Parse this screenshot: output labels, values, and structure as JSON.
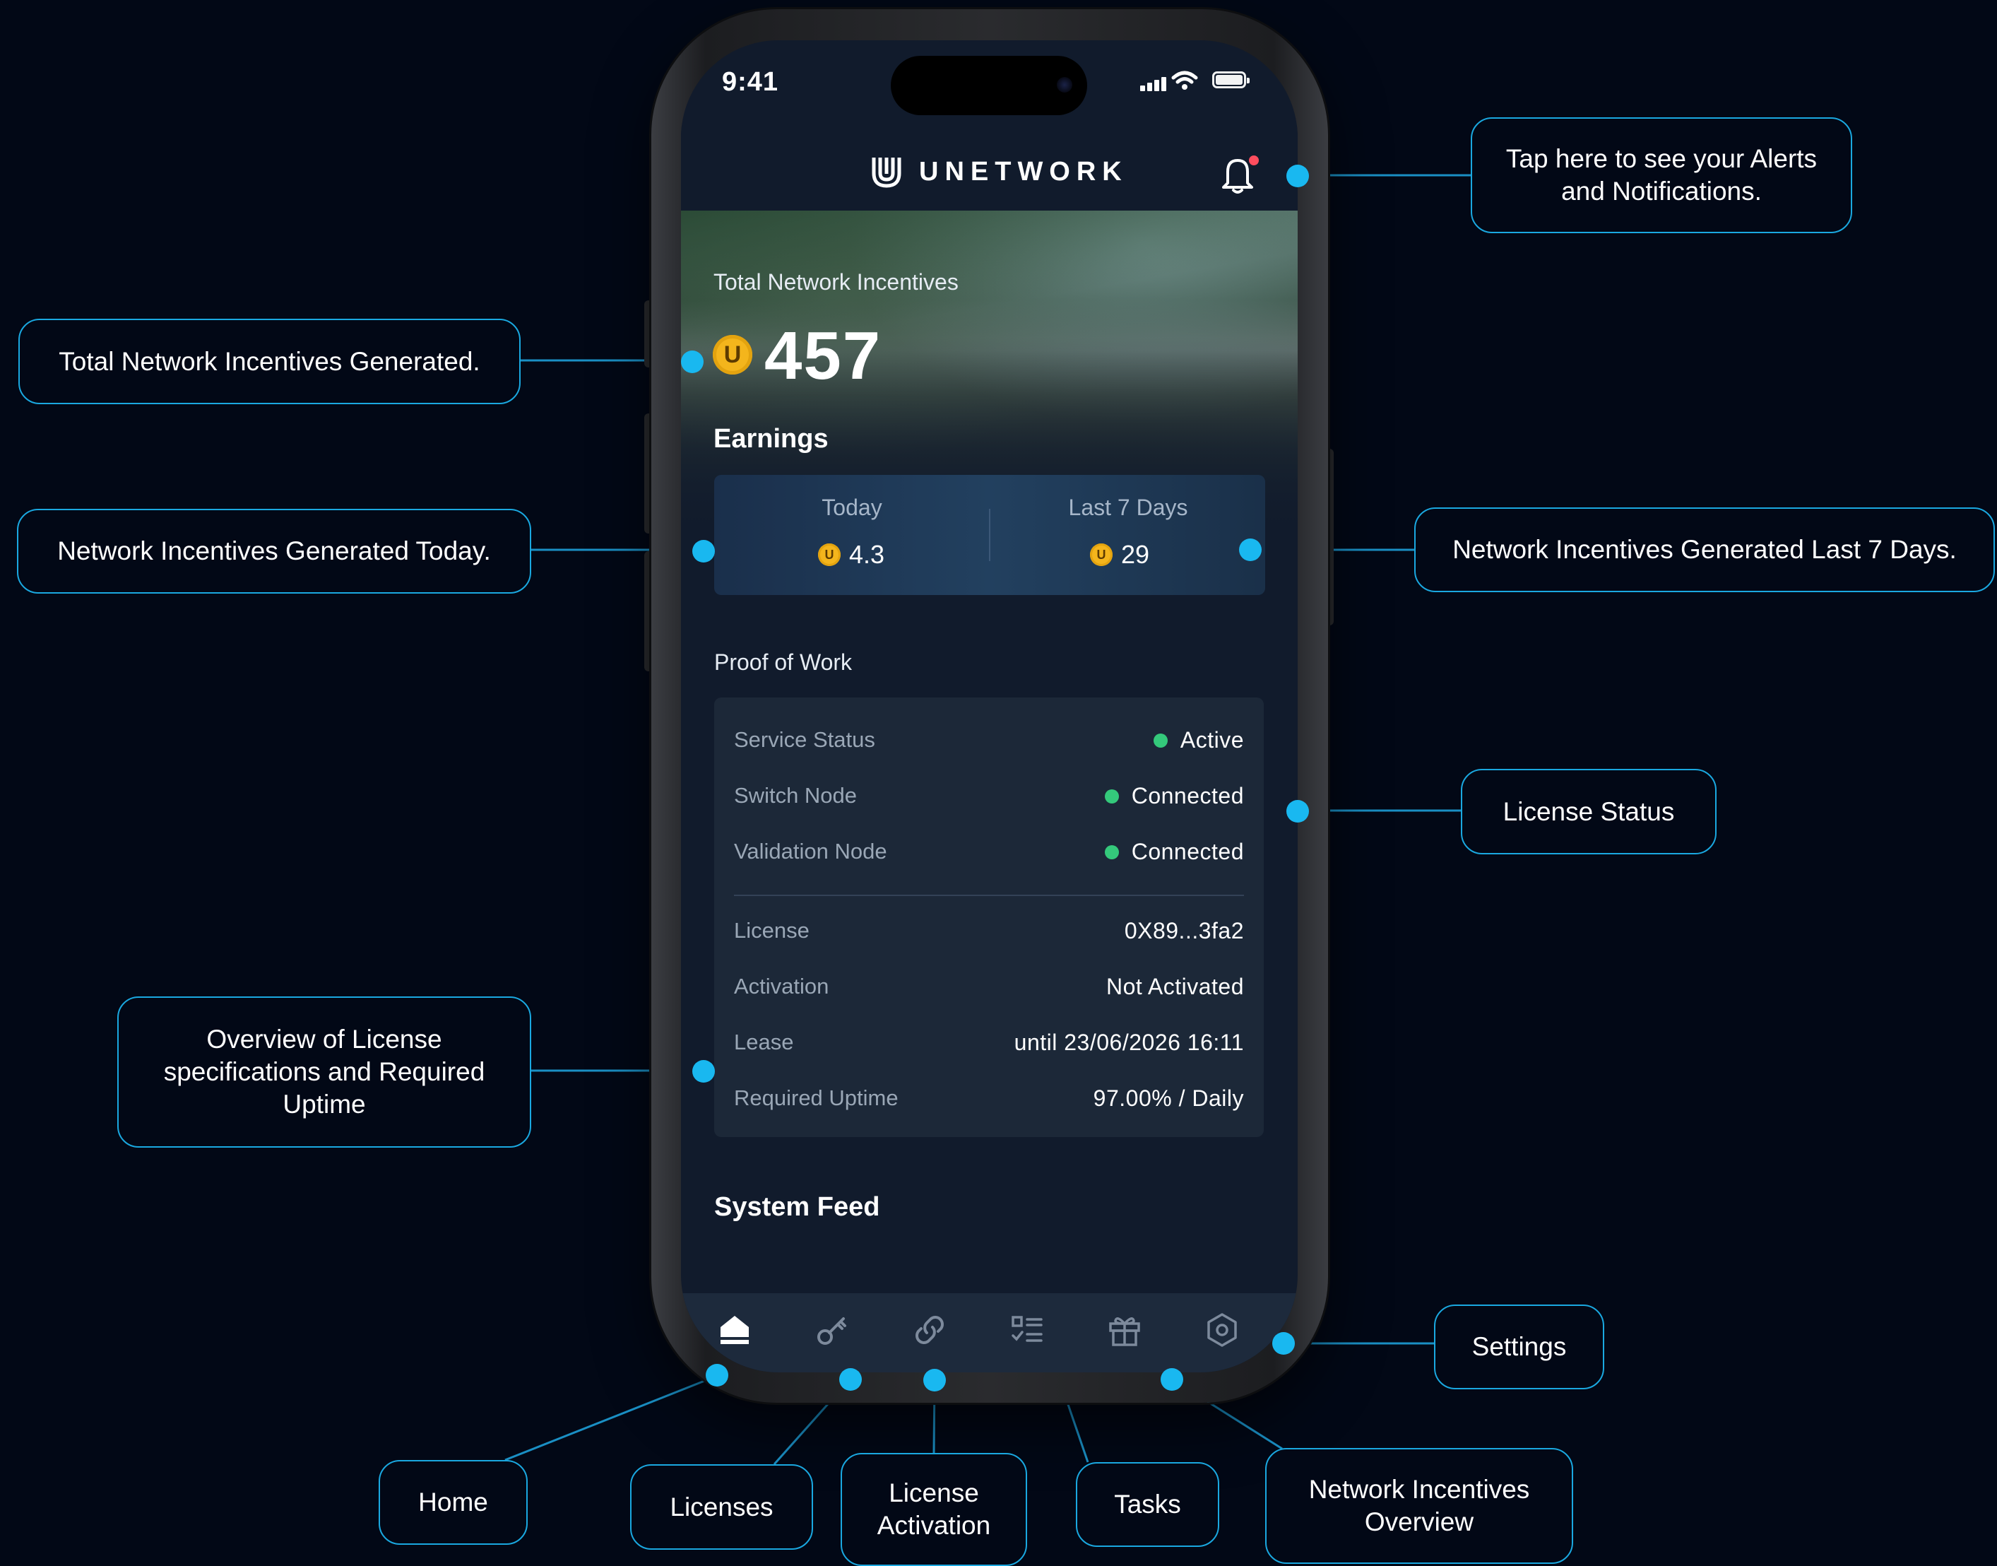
{
  "status_bar": {
    "time": "9:41"
  },
  "header": {
    "brand": "UNETWORK"
  },
  "hero": {
    "total_label": "Total Network Incentives",
    "coin_symbol": "U",
    "total_value": "457",
    "earnings_title": "Earnings"
  },
  "earnings": {
    "today_label": "Today",
    "today_value": "4.3",
    "week_label": "Last 7 Days",
    "week_value": "29"
  },
  "proof_of_work": {
    "title": "Proof of Work",
    "rows": [
      {
        "label": "Service Status",
        "value": "Active"
      },
      {
        "label": "Switch Node",
        "value": "Connected"
      },
      {
        "label": "Validation Node",
        "value": "Connected"
      },
      {
        "label": "License",
        "value": "0X89...3fa2"
      },
      {
        "label": "Activation",
        "value": "Not Activated"
      },
      {
        "label": "Lease",
        "value": "until 23/06/2026 16:11"
      },
      {
        "label": "Required Uptime",
        "value": "97.00% / Daily"
      }
    ]
  },
  "feed": {
    "title": "System Feed"
  },
  "tabs": [
    {
      "icon": "home-icon"
    },
    {
      "icon": "key-icon"
    },
    {
      "icon": "link-icon"
    },
    {
      "icon": "tasks-icon"
    },
    {
      "icon": "gift-icon"
    },
    {
      "icon": "settings-hexagon-icon"
    }
  ],
  "callouts": {
    "alerts": "Tap here to see your Alerts and Notifications.",
    "total": "Total Network Incentives Generated.",
    "today": "Network Incentives Generated Today.",
    "last7": "Network Incentives Generated Last 7 Days.",
    "license_status": "License Status",
    "overview": "Overview of License specifications and Required Uptime",
    "settings": "Settings",
    "home": "Home",
    "licenses": "Licenses",
    "license_activation": "License Activation",
    "tasks": "Tasks",
    "incentives_overview": "Network Incentives Overview"
  },
  "colors": {
    "background": "#020816",
    "accent": "#19b8f0",
    "coin": "#f4b51c",
    "status_green": "#34c97b",
    "notification_dot": "#ff4d5e"
  }
}
